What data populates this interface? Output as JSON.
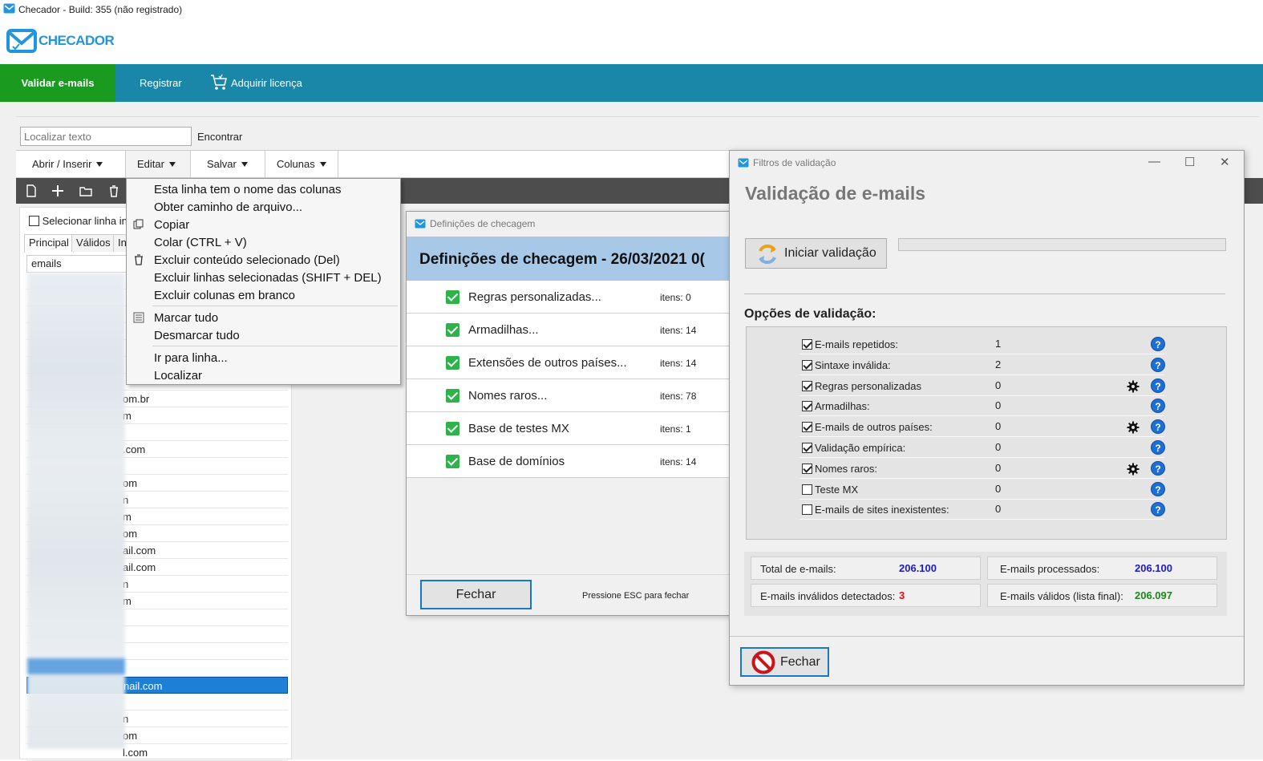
{
  "window": {
    "title": "Checador - Build: 355 (não registrado)"
  },
  "logo": {
    "text": "CHECADOR"
  },
  "nav": {
    "validar": "Validar e-mails",
    "registrar": "Registrar",
    "licenca": "Adquirir licença"
  },
  "search": {
    "placeholder": "Localizar texto",
    "find_label": "Encontrar"
  },
  "menus": {
    "abrir": "Abrir / Inserir",
    "editar": "Editar",
    "salvar": "Salvar",
    "colunas": "Colunas"
  },
  "left": {
    "select_row": "Selecionar linha in",
    "tabs": [
      "Principal",
      "Válidos",
      "In"
    ],
    "column_header": "emails",
    "rows": [
      "",
      "",
      "",
      "",
      "",
      "",
      "",
      "om.br",
      "m",
      "",
      ".com",
      "",
      "om",
      "n",
      "m",
      "om",
      "ail.com",
      "ail.com",
      "n",
      "m",
      "",
      "",
      "",
      "",
      "nail.com",
      "",
      "n",
      "om",
      "l.com"
    ]
  },
  "context_menu": {
    "items": [
      "Esta linha tem o nome das colunas",
      "Obter caminho de arquivo...",
      "Copiar",
      "Colar (CTRL + V)",
      "Excluir conteúdo selecionado (Del)",
      "Excluir linhas selecionadas (SHIFT + DEL)",
      "Excluir colunas em branco",
      "Marcar tudo",
      "Desmarcar tudo",
      "Ir para linha...",
      "Localizar"
    ]
  },
  "def_dialog": {
    "title": "Definições de checagem",
    "heading": "Definições de checagem - 26/03/2021 0(",
    "rows": [
      {
        "label": "Regras personalizadas...",
        "items": "itens: 0"
      },
      {
        "label": "Armadilhas...",
        "items": "itens: 14"
      },
      {
        "label": "Extensões de outros países...",
        "items": "itens: 14"
      },
      {
        "label": "Nomes raros...",
        "items": "itens: 78"
      },
      {
        "label": "Base de testes MX",
        "items": "itens: 1"
      },
      {
        "label": "Base de domínios",
        "items": "itens: 14"
      }
    ],
    "close": "Fechar",
    "esc_hint": "Pressione ESC para fechar"
  },
  "filter_dialog": {
    "title": "Filtros de validação",
    "heading": "Validação de e-mails",
    "start_button": "Iniciar validação",
    "options_title": "Opções de validação:",
    "options": [
      {
        "label": "E-mails repetidos:",
        "value": "1",
        "checked": true,
        "gear": false
      },
      {
        "label": "Sintaxe inválida:",
        "value": "2",
        "checked": true,
        "gear": false
      },
      {
        "label": "Regras personalizadas",
        "value": "0",
        "checked": true,
        "gear": true
      },
      {
        "label": "Armadilhas:",
        "value": "0",
        "checked": true,
        "gear": false
      },
      {
        "label": "E-mails de outros países:",
        "value": "0",
        "checked": true,
        "gear": true
      },
      {
        "label": "Validação empírica:",
        "value": "0",
        "checked": true,
        "gear": false
      },
      {
        "label": "Nomes raros:",
        "value": "0",
        "checked": true,
        "gear": true
      },
      {
        "label": "Teste MX",
        "value": "0",
        "checked": false,
        "gear": false
      },
      {
        "label": "E-mails de sites inexistentes:",
        "value": "0",
        "checked": false,
        "gear": false
      }
    ],
    "help_glyph": "?",
    "stats": {
      "total_label": "Total de e-mails:",
      "total_value": "206.100",
      "processed_label": "E-mails processados:",
      "processed_value": "206.100",
      "invalid_label": "E-mails inválidos detectados:",
      "invalid_value": "3",
      "valid_label": "E-mails válidos (lista final):",
      "valid_value": "206.097"
    },
    "close": "Fechar"
  },
  "colors": {
    "nav_bg": "#1a86a8",
    "validar_bg": "#1a9a1f",
    "blue_value": "#1a1ad0",
    "red_value": "#e01010",
    "green_value": "#1a8a1a",
    "selection": "#1e7fd6"
  }
}
